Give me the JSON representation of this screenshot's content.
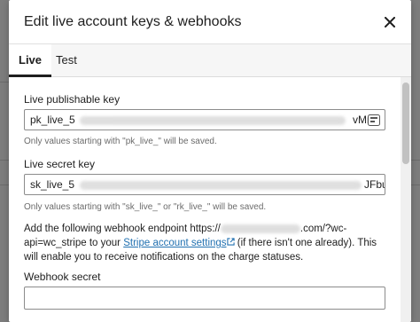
{
  "modal": {
    "title": "Edit live account keys & webhooks",
    "close_icon": "close-icon"
  },
  "tabs": [
    {
      "label": "Live",
      "active": true
    },
    {
      "label": "Test",
      "active": false
    }
  ],
  "publishable": {
    "label": "Live publishable key",
    "value_prefix": "pk_live_5",
    "value_suffix": "vMn",
    "help": "Only values starting with \"pk_live_\" will be saved."
  },
  "secret": {
    "label": "Live secret key",
    "value_prefix": "sk_live_5",
    "value_suffix": "JFbu",
    "help": "Only values starting with \"sk_live_\" or \"rk_live_\" will be saved."
  },
  "webhook_info": {
    "text_1": "Add the following webhook endpoint",
    "endpoint_prefix": "https://",
    "endpoint_suffix": ".com/?wc-",
    "endpoint_line2": "api=wc_stripe",
    "text_2": " to your ",
    "link_label": "Stripe account settings",
    "text_3": " (if there isn't one already). This will enable you to receive notifications on the charge statuses."
  },
  "webhook_secret": {
    "label": "Webhook secret",
    "value": ""
  },
  "colors": {
    "link": "#2271b1",
    "active_tab_indicator": "#1e1e1e"
  }
}
